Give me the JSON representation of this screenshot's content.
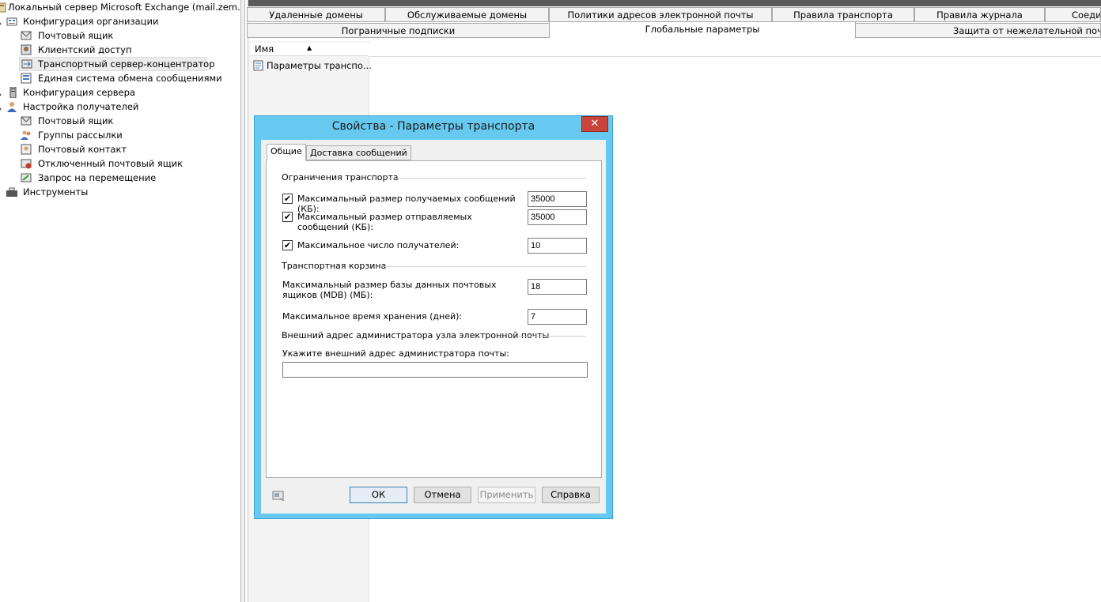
{
  "tree": {
    "items": [
      {
        "label": "Локальный сервер Microsoft Exchange (mail.zem.local",
        "icon": "exchange-server-icon",
        "indent": 0
      },
      {
        "label": "Конфигурация организации",
        "icon": "organization-config-icon",
        "indent": 1
      },
      {
        "label": "Почтовый ящик",
        "icon": "mailbox-icon",
        "indent": 2
      },
      {
        "label": "Клиентский доступ",
        "icon": "client-access-icon",
        "indent": 2
      },
      {
        "label": "Транспортный сервер-концентратор",
        "icon": "hub-transport-icon",
        "indent": 2,
        "selected": true
      },
      {
        "label": "Единая система обмена сообщениями",
        "icon": "unified-messaging-icon",
        "indent": 2
      },
      {
        "label": "Конфигурация сервера",
        "icon": "server-config-icon",
        "indent": 1
      },
      {
        "label": "Настройка получателей",
        "icon": "recipient-config-icon",
        "indent": 1
      },
      {
        "label": "Почтовый ящик",
        "icon": "mailbox-icon",
        "indent": 2
      },
      {
        "label": "Группы рассылки",
        "icon": "distribution-group-icon",
        "indent": 2
      },
      {
        "label": "Почтовый контакт",
        "icon": "mail-contact-icon",
        "indent": 2
      },
      {
        "label": "Отключенный почтовый ящик",
        "icon": "disconnected-mailbox-icon",
        "indent": 2
      },
      {
        "label": "Запрос на перемещение",
        "icon": "move-request-icon",
        "indent": 2
      },
      {
        "label": "Инструменты",
        "icon": "toolbox-icon",
        "indent": 1
      }
    ]
  },
  "tabs": {
    "row1": [
      "Удаленные домены",
      "Обслуживаемые домены",
      "Политики адресов электронной почты",
      "Правила транспорта",
      "Правила журнала",
      "Соеди"
    ],
    "row2": [
      "Пограничные подписки",
      "Глобальные параметры",
      "Защита от нежелательной почты"
    ],
    "active": "Глобальные параметры"
  },
  "list": {
    "column_header": "Имя",
    "items": [
      "Параметры транспо..."
    ]
  },
  "dialog": {
    "title": "Свойства - Параметры транспорта",
    "close": "✕",
    "tabs": [
      "Общие",
      "Доставка сообщений"
    ],
    "active_tab": "Общие",
    "group1": "Ограничения транспорта",
    "max_receive_label": "Максимальный размер получаемых сообщений (КБ):",
    "max_receive_value": "35000",
    "max_receive_checked": true,
    "max_send_label": "Максимальный размер отправляемых сообщений (КБ):",
    "max_send_value": "35000",
    "max_send_checked": true,
    "max_recipients_label": "Максимальное число получателей:",
    "max_recipients_value": "10",
    "max_recipients_checked": true,
    "group2": "Транспортная корзина",
    "dumpster_size_label": "Максимальный размер базы данных почтовых ящиков (MDB) (МБ):",
    "dumpster_size_value": "18",
    "dumpster_time_label": "Максимальное время хранения (дней):",
    "dumpster_time_value": "7",
    "group3": "Внешний адрес администратора узла электронной почты",
    "postmaster_label": "Укажите внешний адрес администратора почты:",
    "postmaster_value": "",
    "buttons": {
      "ok": "ОК",
      "cancel": "Отмена",
      "apply": "Применить",
      "help": "Справка"
    }
  }
}
